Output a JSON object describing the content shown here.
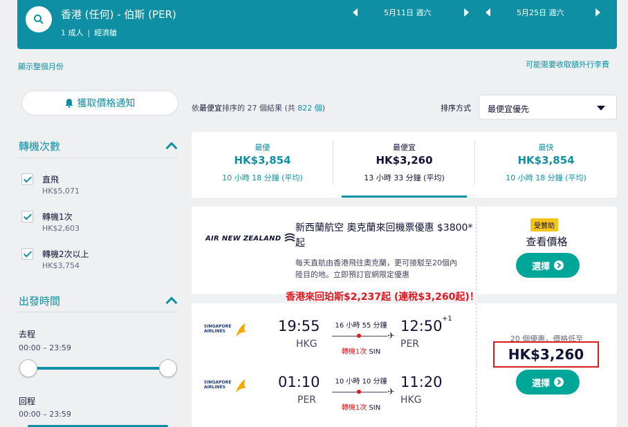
{
  "search": {
    "route": "香港 (任何) - 伯斯 (PER)",
    "passengers": "1 成人",
    "cabin": "經濟艙",
    "depart_date": "5月11日 週六",
    "return_date": "5月25日 週六"
  },
  "links": {
    "show_month": "顯示整個月份",
    "extra_fees": "可能需要收取額外行李費"
  },
  "sidebar": {
    "alert_button": "獲取價格通知",
    "stops_title": "轉機次數",
    "stops": [
      {
        "label": "直飛",
        "price": "HK$5,071"
      },
      {
        "label": "轉機1次",
        "price": "HK$2,603"
      },
      {
        "label": "轉機2次以上",
        "price": "HK$3,754"
      }
    ],
    "times_title": "出發時間",
    "outbound_label": "去程",
    "outbound_range": "00:00 – 23:59",
    "return_label": "回程",
    "return_range": "00:00 – 23:59"
  },
  "results": {
    "prefix": "依",
    "sort_word": "最便宜",
    "middle": "排序的 27 個結果 (共",
    "total": "822 個",
    "suffix": ")",
    "sort_label": "排序方式",
    "sort_value": "最便宜優先"
  },
  "tabs": [
    {
      "title": "最優",
      "price": "HK$3,854",
      "duration": "10 小時 18 分鐘 (平均)"
    },
    {
      "title": "最便宜",
      "price": "HK$3,260",
      "duration": "13 小時 33 分鐘 (平均)"
    },
    {
      "title": "最快",
      "price": "HK$3,854",
      "duration": "10 小時 18 分鐘 (平均)"
    }
  ],
  "ad": {
    "airline_logo": "AIR NEW ZEALAND",
    "title": "新西蘭航空 奧克蘭來回機票優惠 $3800*起",
    "description": "每天直航由香港飛往奧克蘭，更可接駁至20個內陸目的地。立即預訂官網限定優惠",
    "badge": "受贊助",
    "view_price": "查看價格",
    "cta": "選擇"
  },
  "promo_text": "香港來回珀斯$2,237起 (連稅$3,260起)！",
  "flight": {
    "airline_logo_line1": "SINGAPORE",
    "airline_logo_line2": "AIRLINES",
    "legs": [
      {
        "dep_time": "19:55",
        "dep_code": "HKG",
        "duration": "16 小時 55 分鐘",
        "stops": "轉機1次",
        "via": "SIN",
        "arr_time": "12:50",
        "day_offset": "+1",
        "arr_code": "PER"
      },
      {
        "dep_time": "01:10",
        "dep_code": "PER",
        "duration": "10 小時 10 分鐘",
        "stops": "轉機1次",
        "via": "SIN",
        "arr_time": "11:20",
        "day_offset": "",
        "arr_code": "HKG"
      }
    ],
    "deals": "20 個優惠，價格低至",
    "price": "HK$3,260",
    "cta": "選擇"
  },
  "colors": {
    "brand": "#0e8fa3",
    "cta": "#00a698",
    "highlight": "#e0171f"
  }
}
